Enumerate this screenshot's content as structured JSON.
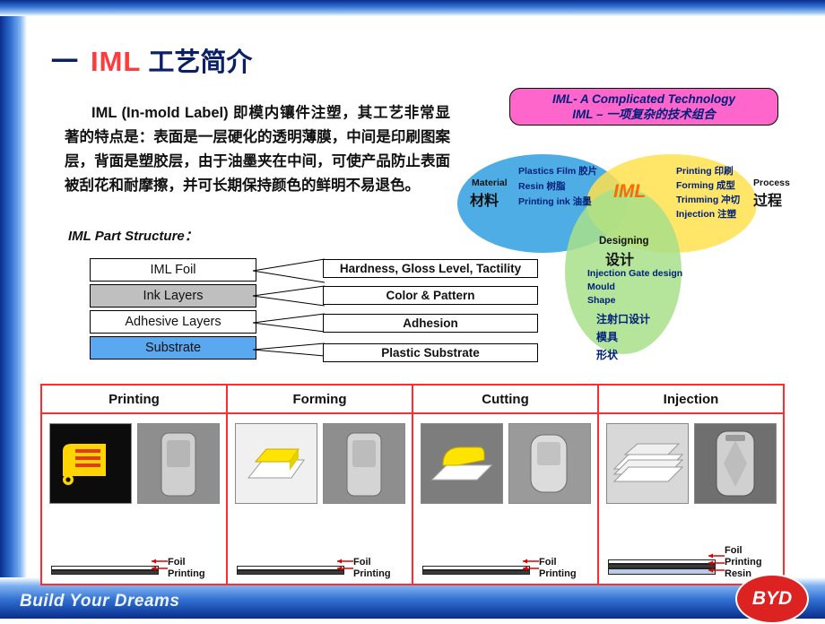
{
  "slide": {
    "title": {
      "number": "一",
      "iml": "IML",
      "cn": "工艺简介"
    },
    "paragraph": "IML (In-mold Label) 即模内镶件注塑，其工艺非常显著的特点是：表面是一层硬化的透明薄膜，中间是印刷图案层，背面是塑胶层，由于油墨夹在中间，可使产品防止表面被刮花和耐摩擦，并可长期保持颜色的鲜明不易退色。",
    "structure_label": "IML Part Structure：",
    "layers": [
      {
        "label": "IML Foil",
        "callout": "Hardness, Gloss Level, Tactility"
      },
      {
        "label": "Ink Layers",
        "callout": "Color & Pattern"
      },
      {
        "label": "Adhesive Layers",
        "callout": "Adhesion"
      },
      {
        "label": "Substrate",
        "callout": "Plastic Substrate"
      }
    ],
    "venn": {
      "header_line1": "IML- A Complicated Technology",
      "header_line2": "IML – 一项复杂的技术组合",
      "material_en": "Material",
      "material_cn": "材料",
      "process_en": "Process",
      "process_cn": "过程",
      "center": "IML",
      "design_en": "Designing",
      "design_cn": "设计",
      "material_items": [
        "Plastics Film 胶片",
        "Resin 树脂",
        "Printing ink 油墨"
      ],
      "process_items": [
        "Printing 印刷",
        "Forming 成型",
        "Trimming 冲切",
        "Injection 注塑"
      ],
      "design_items_en": [
        "Injection Gate design",
        "Mould",
        "Shape"
      ],
      "design_items_cn": [
        "注射口设计",
        "模具",
        "形状"
      ]
    },
    "table": {
      "headers": [
        "Printing",
        "Forming",
        "Cutting",
        "Injection"
      ],
      "columns": [
        {
          "caption": [
            "Foil",
            "Printing"
          ]
        },
        {
          "caption": [
            "Foil",
            "Printing"
          ]
        },
        {
          "caption": [
            "Foil",
            "Printing"
          ]
        },
        {
          "caption": [
            "Foil",
            "Printing",
            "Resin"
          ]
        }
      ]
    },
    "footer": {
      "tagline": "Build Your Dreams",
      "logo": "BYD"
    }
  }
}
